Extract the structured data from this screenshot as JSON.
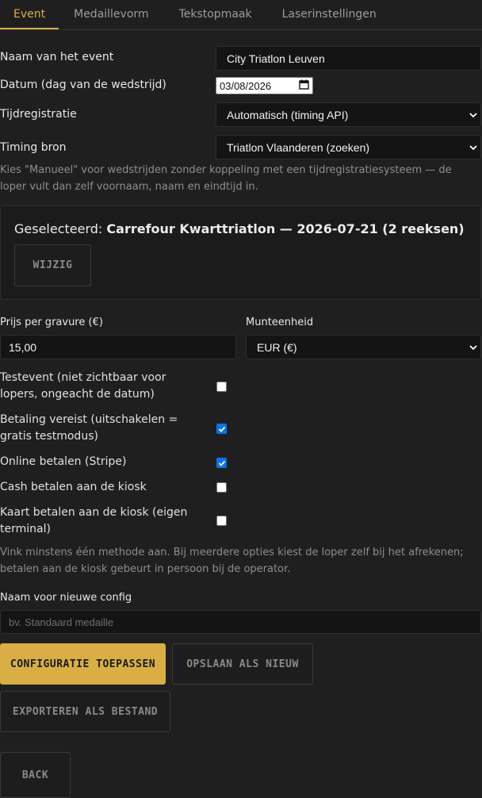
{
  "tabs": [
    {
      "label": "Event",
      "active": true
    },
    {
      "label": "Medaillevorm",
      "active": false
    },
    {
      "label": "Tekstopmaak",
      "active": false
    },
    {
      "label": "Laserinstellingen",
      "active": false
    }
  ],
  "form": {
    "event_name": {
      "label": "Naam van het event",
      "value": "City Triatlon Leuven"
    },
    "date": {
      "label": "Datum (dag van de wedstrijd)",
      "value": "03/08/2026"
    },
    "timing": {
      "label": "Tijdregistratie",
      "value": "Automatisch (timing API)"
    },
    "timing_source": {
      "label": "Timing bron",
      "value": "Triatlon Vlaanderen (zoeken)"
    },
    "help_manual": "Kies \"Manueel\" voor wedstrijden zonder koppeling met een tijdregistratiesysteem — de loper vult dan zelf voornaam, naam en eindtijd in."
  },
  "selected": {
    "prefix": "Geselecteerd:",
    "value": "Carrefour Kwarttriatlon — 2026-07-21 (2 reeksen)",
    "change_button": "WIJZIG"
  },
  "pricing": {
    "price_label": "Prijs per gravure (€)",
    "price_value": "15,00",
    "currency_label": "Munteenheid",
    "currency_value": "EUR (€)"
  },
  "checkboxes": [
    {
      "label": "Testevent (niet zichtbaar voor lopers, ongeacht de datum)",
      "checked": false
    },
    {
      "label": "Betaling vereist (uitschakelen = gratis testmodus)",
      "checked": true
    },
    {
      "label": "Online betalen (Stripe)",
      "checked": true
    },
    {
      "label": "Cash betalen aan de kiosk",
      "checked": false
    },
    {
      "label": "Kaart betalen aan de kiosk (eigen terminal)",
      "checked": false
    }
  ],
  "help_payment": "Vink minstens één methode aan. Bij meerdere opties kiest de loper zelf bij het afrekenen; betalen aan de kiosk gebeurt in persoon bij de operator.",
  "config": {
    "name_label": "Naam voor nieuwe config",
    "name_placeholder": "bv. Standaard medaille"
  },
  "buttons": {
    "apply": "CONFIGURATIE TOEPASSEN",
    "save_new": "OPSLAAN ALS NIEUW",
    "export": "EXPORTEREN ALS BESTAND",
    "back": "BACK"
  },
  "colors": {
    "accent": "#d9ae45",
    "checkbox_on": "#0a74e8",
    "background": "#1f1f1f"
  }
}
